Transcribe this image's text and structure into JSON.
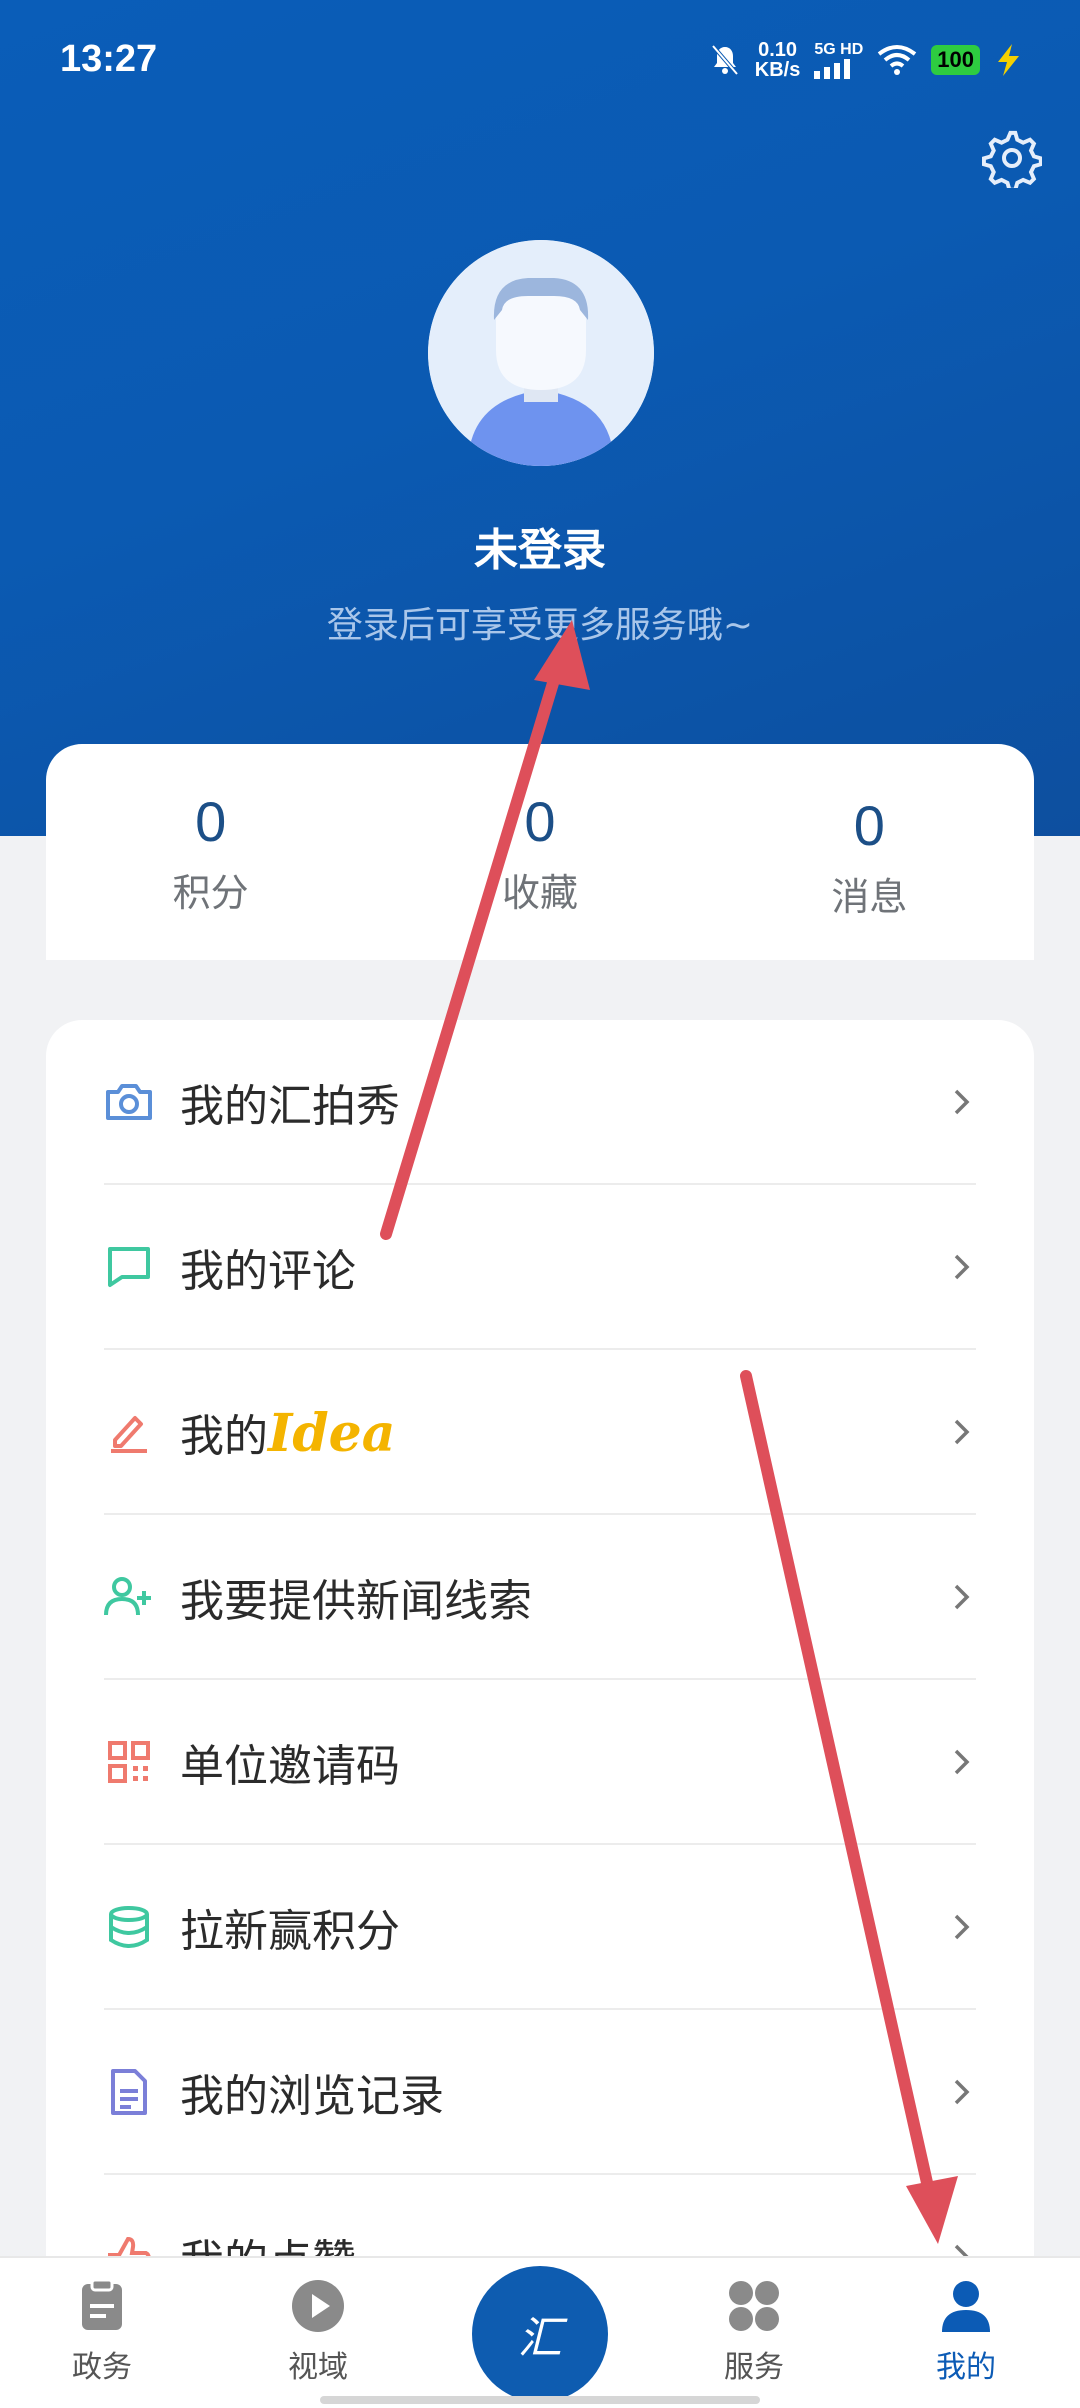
{
  "status": {
    "time": "13:27",
    "speed_value": "0.10",
    "speed_unit": "KB/s",
    "network": "5G HD",
    "battery": "100"
  },
  "profile": {
    "name": "未登录",
    "hint": "登录后可享受更多服务哦~"
  },
  "stats": [
    {
      "value": "0",
      "label": "积分"
    },
    {
      "value": "0",
      "label": "收藏"
    },
    {
      "value": "0",
      "label": "消息"
    }
  ],
  "menu": [
    {
      "label": "我的汇拍秀",
      "icon": "camera-icon",
      "color": "#5b8fd8"
    },
    {
      "label": "我的评论",
      "icon": "comment-icon",
      "color": "#3fc8a0"
    },
    {
      "label": "我的",
      "label_suffix": "Idea",
      "icon": "pencil-icon",
      "color": "#ef7a6e"
    },
    {
      "label": "我要提供新闻线索",
      "icon": "add-user-icon",
      "color": "#3fc8a0"
    },
    {
      "label": "单位邀请码",
      "icon": "qr-code-icon",
      "color": "#ef7a6e"
    },
    {
      "label": "拉新赢积分",
      "icon": "database-icon",
      "color": "#3fc8a0"
    },
    {
      "label": "我的浏览记录",
      "icon": "document-icon",
      "color": "#7b7fd8"
    },
    {
      "label": "我的点赞",
      "icon": "thumbs-up-icon",
      "color": "#ef7a6e"
    }
  ],
  "nav": {
    "items": [
      {
        "label": "政务",
        "icon": "clipboard-icon"
      },
      {
        "label": "视域",
        "icon": "play-icon"
      },
      {
        "label": "服务",
        "icon": "grid-icon"
      },
      {
        "label": "我的",
        "icon": "person-icon"
      }
    ],
    "center_logo": "汇",
    "active_color": "#0c5bb5",
    "inactive_color": "#8a8a8a"
  },
  "colors": {
    "header": "#0b5ab2",
    "annotation_arrow": "#de4f5a"
  }
}
